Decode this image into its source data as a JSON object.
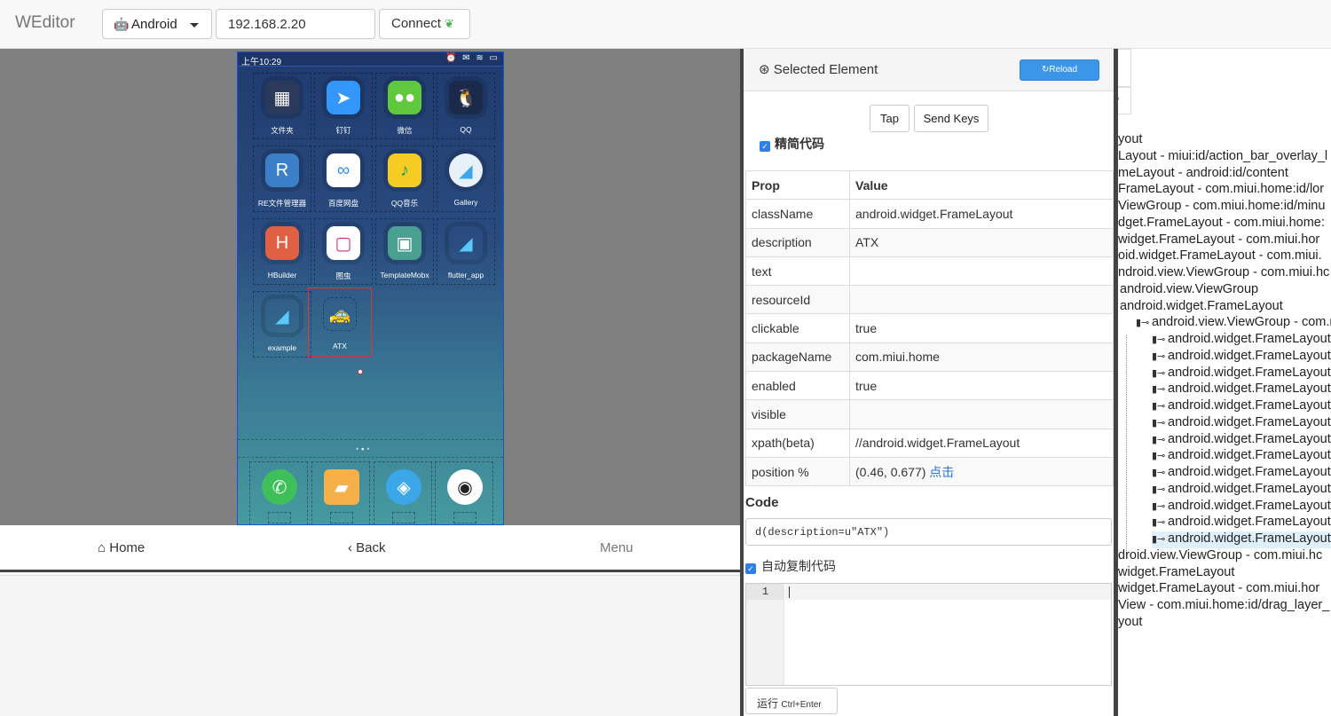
{
  "navbar": {
    "brand": "WEditor",
    "platform": "Android",
    "serial": "192.168.2.20",
    "connect_label": "Connect"
  },
  "device": {
    "status_time": "上午10:29",
    "status_icons": "⏰ ✉ ≋ ▭",
    "apps": [
      "文件夹",
      "钉钉",
      "微信",
      "QQ",
      "RE文件管理器",
      "百度网盘",
      "QQ音乐",
      "Gallery",
      "HBuilder",
      "图虫",
      "TemplateMobx",
      "flutter_app",
      "example",
      "ATX"
    ],
    "nav": {
      "home": "Home",
      "back": "Back",
      "menu": "Menu"
    }
  },
  "inspector": {
    "title": "Selected Element",
    "reload": "Reload",
    "tap": "Tap",
    "send_keys": "Send Keys",
    "simple_code": "精简代码",
    "table_header": {
      "prop": "Prop",
      "value": "Value"
    },
    "rows": [
      {
        "prop": "className",
        "value": "android.widget.FrameLayout"
      },
      {
        "prop": "description",
        "value": "ATX"
      },
      {
        "prop": "text",
        "value": ""
      },
      {
        "prop": "resourceId",
        "value": ""
      },
      {
        "prop": "clickable",
        "value": "true"
      },
      {
        "prop": "packageName",
        "value": "com.miui.home"
      },
      {
        "prop": "enabled",
        "value": "true"
      },
      {
        "prop": "visible",
        "value": ""
      },
      {
        "prop": "xpath(beta)",
        "value": "//android.widget.FrameLayout"
      },
      {
        "prop": "position %",
        "value": "(0.46, 0.677)",
        "link": "点击"
      }
    ],
    "code_label": "Code",
    "code_value": "d(description=u\"ATX\")",
    "auto_copy": "自动复制代码",
    "line_number": "1",
    "run_label": "运行",
    "run_shortcut": "Ctrl+Enter"
  },
  "tree": {
    "rows": [
      "yout",
      "Layout - miui:id/action_bar_overlay_l",
      "meLayout - android:id/content",
      "FrameLayout - com.miui.home:id/lor",
      "ViewGroup - com.miui.home:id/minu",
      "dget.FrameLayout - com.miui.home:",
      "widget.FrameLayout - com.miui.hor",
      "oid.widget.FrameLayout - com.miui.",
      "ndroid.view.ViewGroup - com.miui.hc",
      " android.view.ViewGroup",
      " android.widget.FrameLayout",
      "android.view.ViewGroup - com.m",
      "android.widget.FrameLayout",
      "android.widget.FrameLayout",
      "android.widget.FrameLayout",
      "android.widget.FrameLayout",
      "android.widget.FrameLayout",
      "android.widget.FrameLayout",
      "android.widget.FrameLayout",
      "android.widget.FrameLayout",
      "android.widget.FrameLayout",
      "android.widget.FrameLayout",
      "android.widget.FrameLayout",
      "android.widget.FrameLayout",
      "android.widget.FrameLayout",
      "droid.view.ViewGroup - com.miui.hc",
      "widget.FrameLayout",
      "widget.FrameLayout - com.miui.hor",
      "View - com.miui.home:id/drag_layer_",
      "yout"
    ]
  },
  "colors": {
    "accent": "#3b95e8",
    "selection": "#e8332a"
  }
}
